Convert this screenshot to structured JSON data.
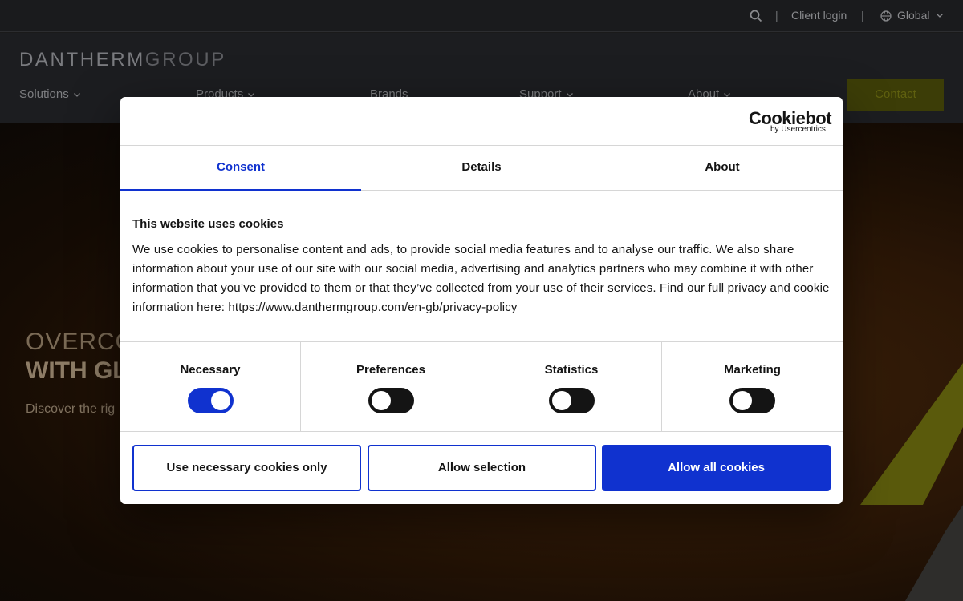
{
  "topbar": {
    "client_login": "Client login",
    "region": "Global",
    "separator": "|"
  },
  "header": {
    "logo_bold": "DANTHERM",
    "logo_light": "GROUP",
    "nav": [
      "Solutions",
      "Products",
      "Brands",
      "Support",
      "About"
    ],
    "contact": "Contact"
  },
  "hero": {
    "title_line1": "OVERCO",
    "title_line2": "WITH GL",
    "subtitle": "Discover the rig"
  },
  "cookie_dialog": {
    "brand": "Cookiebot",
    "brand_by": "by Usercentrics",
    "tabs": [
      "Consent",
      "Details",
      "About"
    ],
    "active_tab": "Consent",
    "title": "This website uses cookies",
    "text": "We use cookies to personalise content and ads, to provide social media features and to analyse our traffic. We also share information about your use of our site with our social media, advertising and analytics partners who may combine it with other information that you’ve provided to them or that they’ve collected from your use of their services. Find our full privacy and cookie information here: https://www.danthermgroup.com/en-gb/privacy-policy",
    "categories": [
      {
        "label": "Necessary",
        "enabled": true
      },
      {
        "label": "Preferences",
        "enabled": false
      },
      {
        "label": "Statistics",
        "enabled": false
      },
      {
        "label": "Marketing",
        "enabled": false
      }
    ],
    "buttons": {
      "necessary_only": "Use necessary cookies only",
      "allow_selection": "Allow selection",
      "allow_all": "Allow all cookies"
    }
  },
  "colors": {
    "accent_blue": "#1032cf",
    "contact_olive": "#3c3d07"
  }
}
